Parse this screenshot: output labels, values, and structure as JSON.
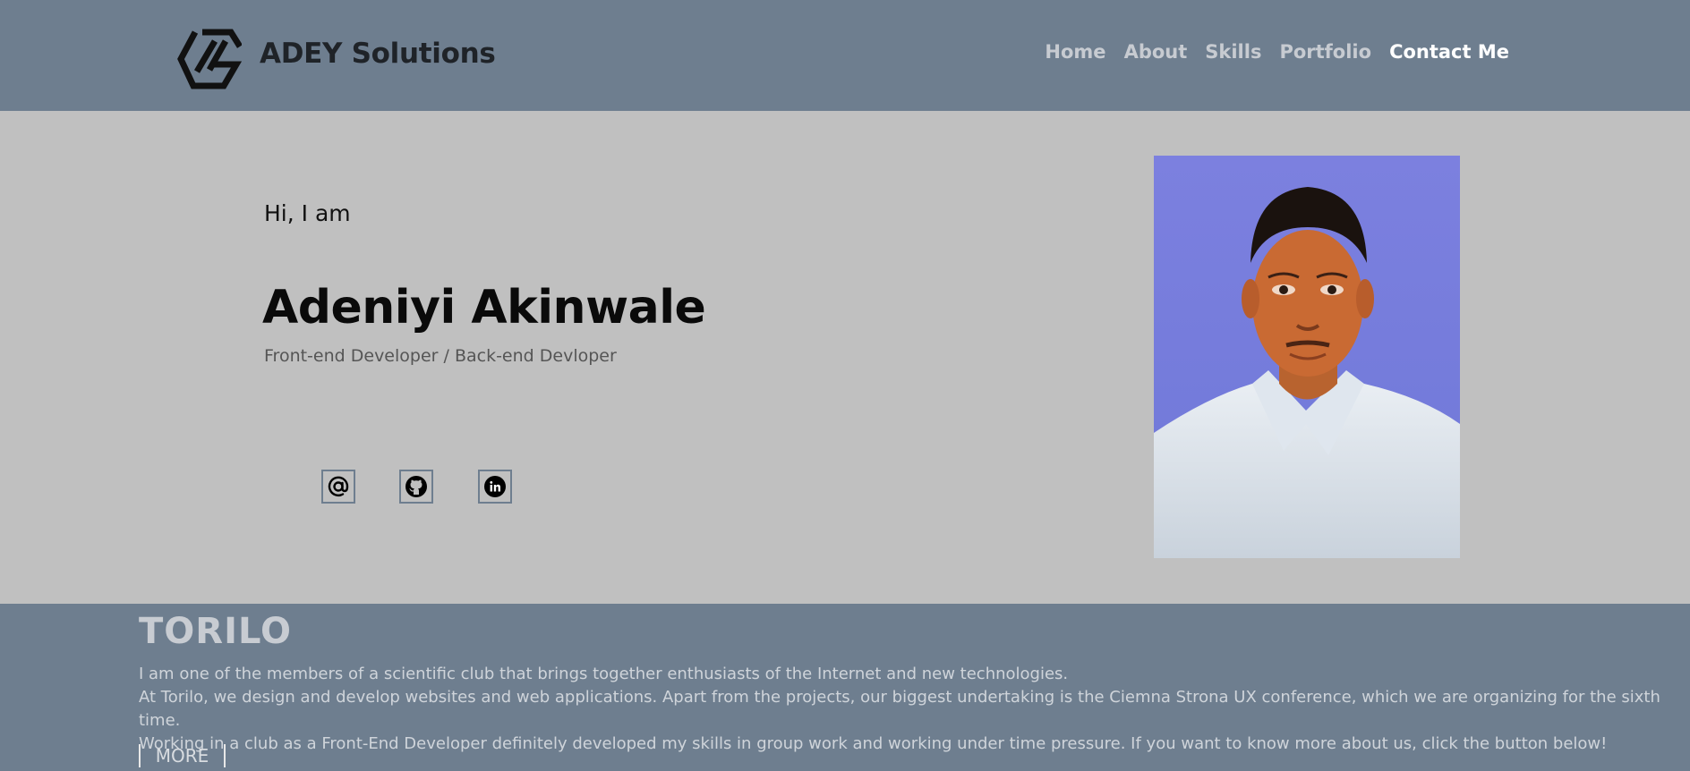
{
  "brand": {
    "name": "ADEY Solutions",
    "logo_icon": "hexagon-g-logo-icon"
  },
  "nav": {
    "items": [
      {
        "label": "Home"
      },
      {
        "label": "About"
      },
      {
        "label": "Skills"
      },
      {
        "label": "Portfolio"
      },
      {
        "label": "Contact Me"
      }
    ],
    "active_item": "Contact Me"
  },
  "hero": {
    "greeting": "Hi, I am",
    "name": "Adeniyi Akinwale",
    "role": "Front-end Developer / Back-end Devloper",
    "social": [
      {
        "icon": "at-sign-icon"
      },
      {
        "icon": "github-icon"
      },
      {
        "icon": "linkedin-icon"
      }
    ]
  },
  "about": {
    "title": "TORILO",
    "lines": [
      "I am one of the members of a scientific club that brings together enthusiasts of the Internet and new technologies.",
      "At Torilo, we design and develop websites and web applications. Apart from the projects, our biggest undertaking is the Ciemna Strona UX conference, which we are organizing for the sixth time.",
      "Working in a club as a Front-End Developer definitely developed my skills in group work and working under time pressure. If you want to know more about us, click the button below!"
    ],
    "button_label": "MORE"
  },
  "colors": {
    "header_bg": "#6e7e8f",
    "hero_bg": "#c0c0c0",
    "nav_link": "#c7cbd1",
    "nav_active": "#ffffff",
    "photo_bg": "#6f78d8"
  }
}
